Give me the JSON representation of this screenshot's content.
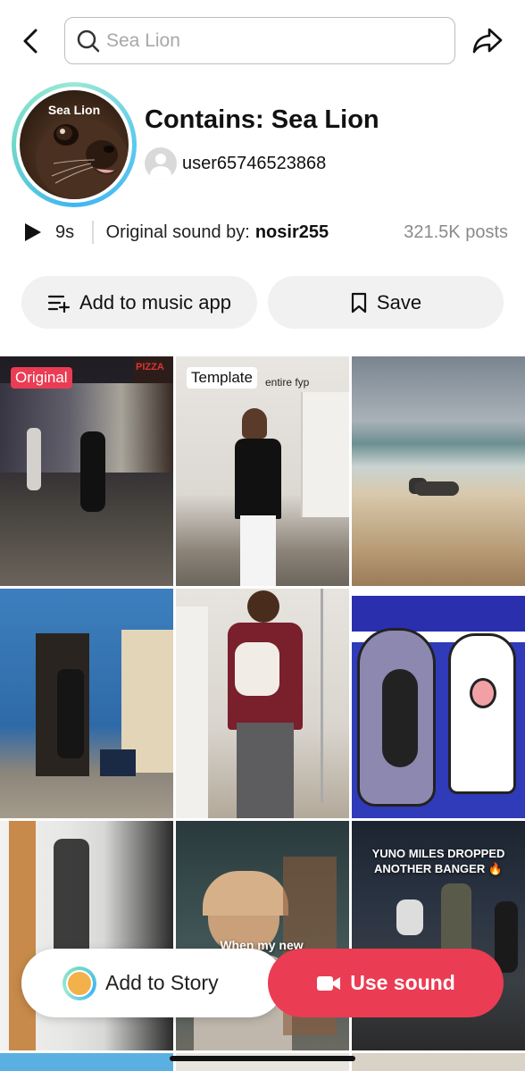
{
  "search": {
    "placeholder": "Sea Lion"
  },
  "header": {
    "back_icon": "chevron-left-icon",
    "share_icon": "share-arrow-icon"
  },
  "sound": {
    "avatar_label": "Sea Lion",
    "title": "Contains: Sea Lion",
    "user": "user65746523868",
    "duration": "9s",
    "original_sound_prefix": "Original sound by:",
    "original_author": "nosir255",
    "posts": "321.5K posts"
  },
  "actions": {
    "add_to_music_app": "Add to music app",
    "save": "Save"
  },
  "grid": {
    "badges": {
      "original": "Original",
      "template": "Template"
    },
    "tile_texts": {
      "tile2_caption": "entire fyp",
      "tile9_caption": "YUNO MILES DROPPED ANOTHER BANGER 🔥",
      "tile8_caption": "When my new ...ches ...o s... ...eco... ...wkey h... sea lion",
      "tile1_storefront": "PIZZA"
    }
  },
  "bottom": {
    "add_to_story": "Add to Story",
    "use_sound": "Use sound"
  },
  "colors": {
    "accent_red": "#ea3c53",
    "ring_teal": "#5cc9ef",
    "button_bg": "#f1f1f2"
  }
}
